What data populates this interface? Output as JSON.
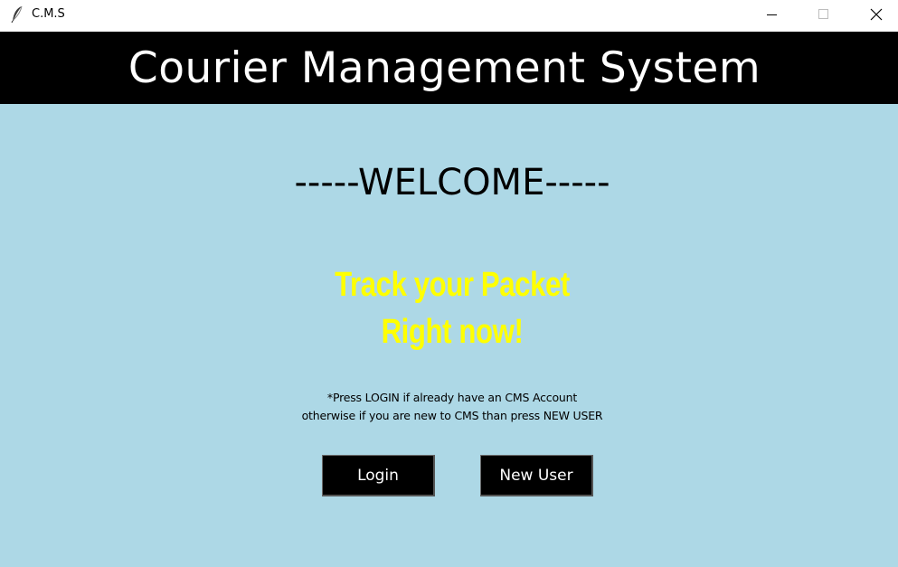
{
  "window": {
    "title": "C.M.S",
    "icon": "feather-icon",
    "controls": {
      "minimize": "minimize-icon",
      "maximize": "maximize-icon",
      "close": "close-icon"
    }
  },
  "header": {
    "title": "Courier Management System",
    "background": "#000000",
    "color": "#ffffff"
  },
  "main": {
    "background": "#add8e6",
    "welcome": "-----WELCOME-----",
    "tagline": [
      "Track your Packet",
      "Right now!"
    ],
    "tagline_color": "#ffff00",
    "hint": [
      "*Press LOGIN if already have an CMS Account",
      "otherwise if you are new to CMS than press NEW USER"
    ],
    "buttons": {
      "login": "Login",
      "new_user": "New User"
    }
  }
}
